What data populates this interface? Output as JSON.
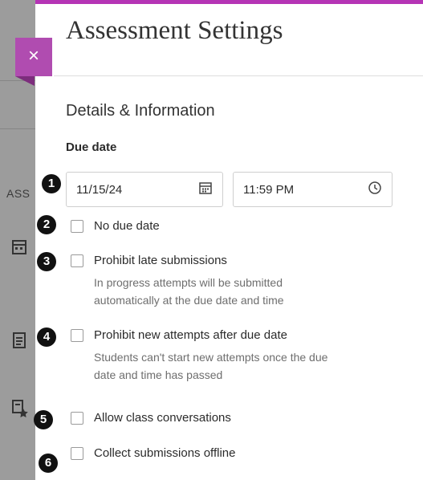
{
  "background": {
    "partial_text": "ASS",
    "icons": [
      "calendar-icon",
      "document-icon",
      "grade-star-icon"
    ]
  },
  "panel": {
    "accent_color": "#b534b5",
    "close_icon": "×",
    "title": "Assessment Settings",
    "section_title": "Details & Information",
    "due_date": {
      "label": "Due date",
      "date_value": "11/15/24",
      "time_value": "11:59 PM"
    },
    "markers": [
      "1",
      "2",
      "3",
      "4",
      "5",
      "6"
    ],
    "options": [
      {
        "label": "No due date",
        "checked": false
      },
      {
        "label": "Prohibit late submissions",
        "checked": false,
        "help_line1": "In progress attempts will be submitted",
        "help_line2": "automatically at the due date and time"
      },
      {
        "label": "Prohibit new attempts after due date",
        "checked": false,
        "help_line1": "Students can't start new attempts once the due",
        "help_line2": "date and time has passed"
      },
      {
        "label": "Allow class conversations",
        "checked": false
      },
      {
        "label": "Collect submissions offline",
        "checked": false
      }
    ]
  }
}
